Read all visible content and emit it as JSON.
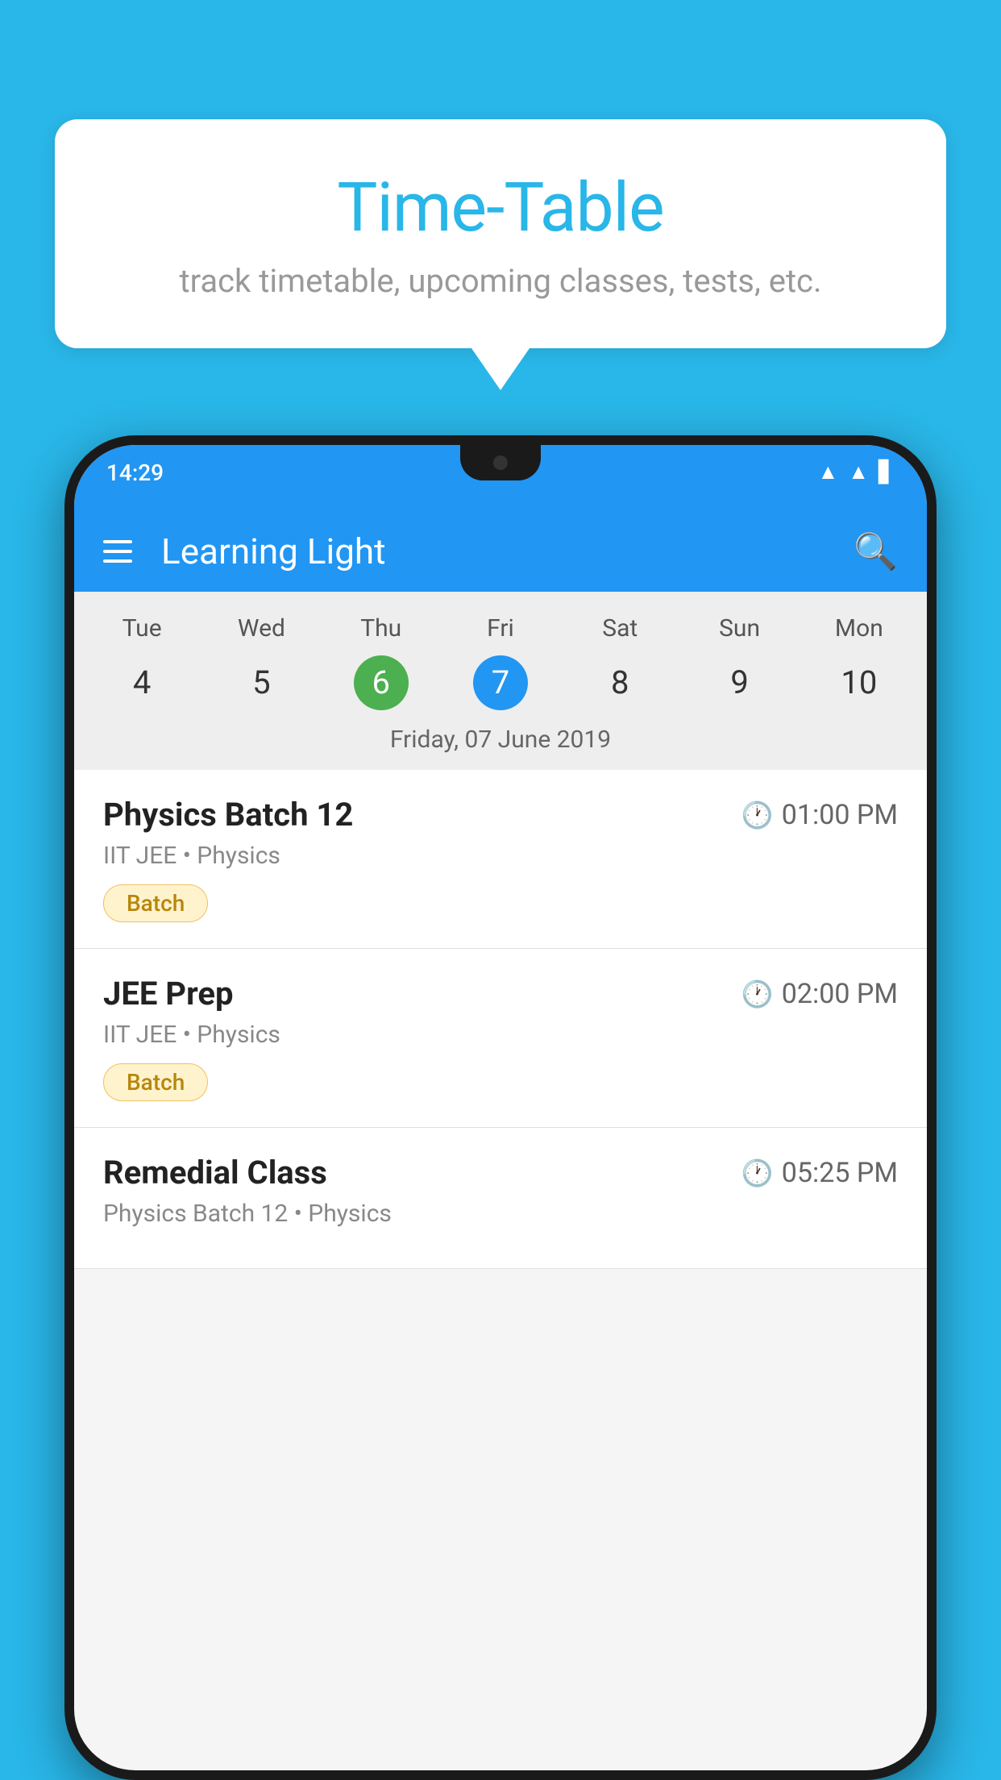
{
  "background_color": "#29b6e8",
  "speech_bubble": {
    "title": "Time-Table",
    "subtitle": "track timetable, upcoming classes, tests, etc."
  },
  "phone": {
    "status_bar": {
      "time": "14:29",
      "icons": [
        "wifi",
        "signal",
        "battery"
      ]
    },
    "app_bar": {
      "title": "Learning Light",
      "menu_label": "menu",
      "search_label": "search"
    },
    "calendar": {
      "days": [
        "Tue",
        "Wed",
        "Thu",
        "Fri",
        "Sat",
        "Sun",
        "Mon"
      ],
      "dates": [
        "4",
        "5",
        "6",
        "7",
        "8",
        "9",
        "10"
      ],
      "today_index": 2,
      "selected_index": 3,
      "selected_date_label": "Friday, 07 June 2019"
    },
    "schedule": [
      {
        "title": "Physics Batch 12",
        "time": "01:00 PM",
        "subtitle": "IIT JEE • Physics",
        "badge": "Batch"
      },
      {
        "title": "JEE Prep",
        "time": "02:00 PM",
        "subtitle": "IIT JEE • Physics",
        "badge": "Batch"
      },
      {
        "title": "Remedial Class",
        "time": "05:25 PM",
        "subtitle": "Physics Batch 12 • Physics",
        "badge": null
      }
    ]
  }
}
